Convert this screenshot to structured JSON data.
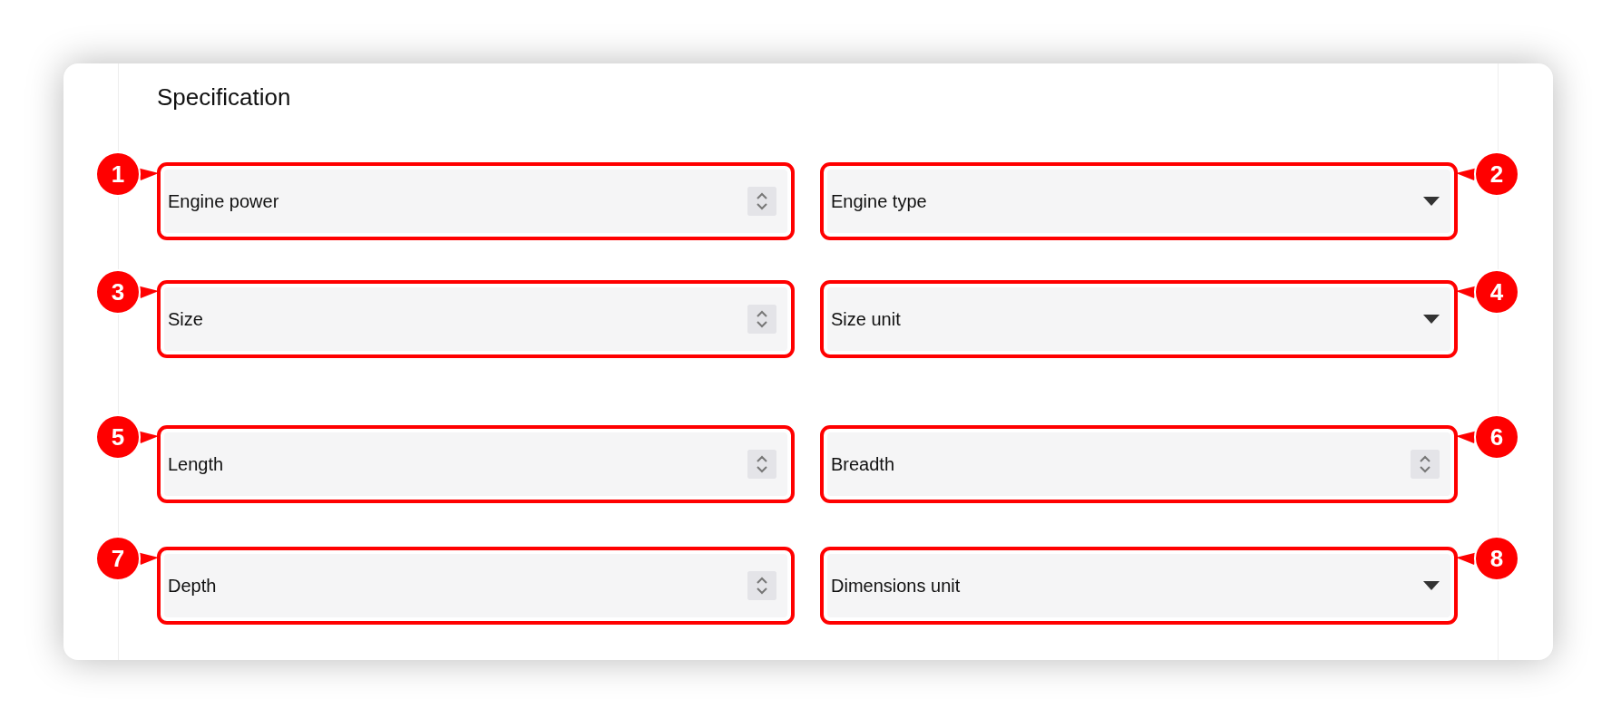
{
  "section": {
    "title": "Specification"
  },
  "fields": [
    {
      "label": "Engine power",
      "kind": "number",
      "callout": "1"
    },
    {
      "label": "Engine type",
      "kind": "select",
      "callout": "2"
    },
    {
      "label": "Size",
      "kind": "number",
      "callout": "3"
    },
    {
      "label": "Size unit",
      "kind": "select",
      "callout": "4"
    },
    {
      "label": "Length",
      "kind": "number",
      "callout": "5"
    },
    {
      "label": "Breadth",
      "kind": "number",
      "callout": "6"
    },
    {
      "label": "Depth",
      "kind": "number",
      "callout": "7"
    },
    {
      "label": "Dimensions unit",
      "kind": "select",
      "callout": "8"
    }
  ]
}
